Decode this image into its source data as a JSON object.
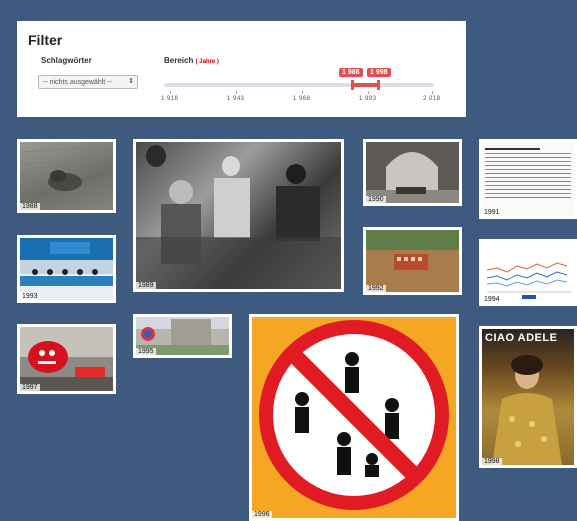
{
  "filter": {
    "title": "Filter",
    "schlagwoerter_label": "Schlagwörter",
    "select_value": "-- nichts ausgewählt --",
    "range_label": "Bereich",
    "range_unit": "( Jahre )",
    "range_from": "1 988",
    "range_to": "1 998",
    "ticks": [
      "1 918",
      "1 943",
      "1 968",
      "1 993",
      "2 018"
    ]
  },
  "thumbnails": [
    {
      "year": "1988",
      "icon": "sculpture-photo"
    },
    {
      "year": "1989",
      "icon": "crowd-photo"
    },
    {
      "year": "1990",
      "icon": "arch-photo"
    },
    {
      "year": "1991",
      "icon": "document-page"
    },
    {
      "year": "1993",
      "icon": "conference-photo"
    },
    {
      "year": "1992",
      "icon": "excavation-photo"
    },
    {
      "year": "1994",
      "icon": "chart-page"
    },
    {
      "year": "1995",
      "icon": "building-photo"
    },
    {
      "year": "1997",
      "icon": "red-mascot-photo"
    },
    {
      "year": "1996",
      "icon": "no-fighting-sign"
    },
    {
      "year": "1998",
      "icon": "adele-poster"
    }
  ],
  "poster_text": "CIAO ADELE",
  "colors": {
    "background": "#3e5a7e",
    "accent": "#e05050",
    "sign_yellow": "#f5a623",
    "sign_red": "#e01b24"
  }
}
